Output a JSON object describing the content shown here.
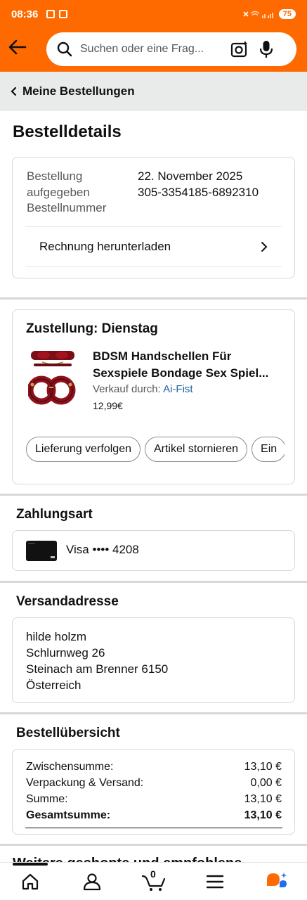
{
  "status_bar": {
    "time": "08:36",
    "battery": "75"
  },
  "search": {
    "placeholder": "Suchen oder eine Frag..."
  },
  "breadcrumb": {
    "label": "Meine Bestellungen"
  },
  "page_title": "Bestelldetails",
  "order_details": {
    "label_lines": [
      "Bestellung",
      "aufgegeben",
      "Bestellnummer"
    ],
    "order_date": "22. November 2025",
    "order_number": "305-3354185-6892310",
    "invoice_label": "Rechnung herunterladen"
  },
  "delivery": {
    "title": "Zustellung: Dienstag",
    "product_title_line1": "BDSM Handschellen Für",
    "product_title_line2": "Sexspiele Bondage Sex Spiel...",
    "sold_by_label": "Verkauf durch: ",
    "seller": "Ai-Fist",
    "price": "12,99€",
    "actions": [
      "Lieferung verfolgen",
      "Artikel stornieren",
      "Ein"
    ]
  },
  "payment": {
    "heading": "Zahlungsart",
    "method": "Visa •••• 4208"
  },
  "shipping": {
    "heading": "Versandadresse",
    "lines": [
      "hilde holzm",
      "Schlurnweg 26",
      "Steinach am Brenner 6150",
      "Österreich"
    ]
  },
  "summary": {
    "heading": "Bestellübersicht",
    "rows": [
      {
        "label": "Zwischensumme:",
        "value": "13,10 €"
      },
      {
        "label": "Verpackung & Versand:",
        "value": "0,00 €"
      },
      {
        "label": "Summe:",
        "value": "13,10 €"
      },
      {
        "label": "Gesamtsumme:",
        "value": "13,10 €"
      }
    ]
  },
  "next_section_peek": "Weitere geshopte und empfohlene Artikel",
  "bottom_nav": {
    "cart_count": "0"
  },
  "colors": {
    "header": "#ff6a00",
    "link": "#2162a1",
    "breadcrumb_bg": "#e9eaea"
  }
}
